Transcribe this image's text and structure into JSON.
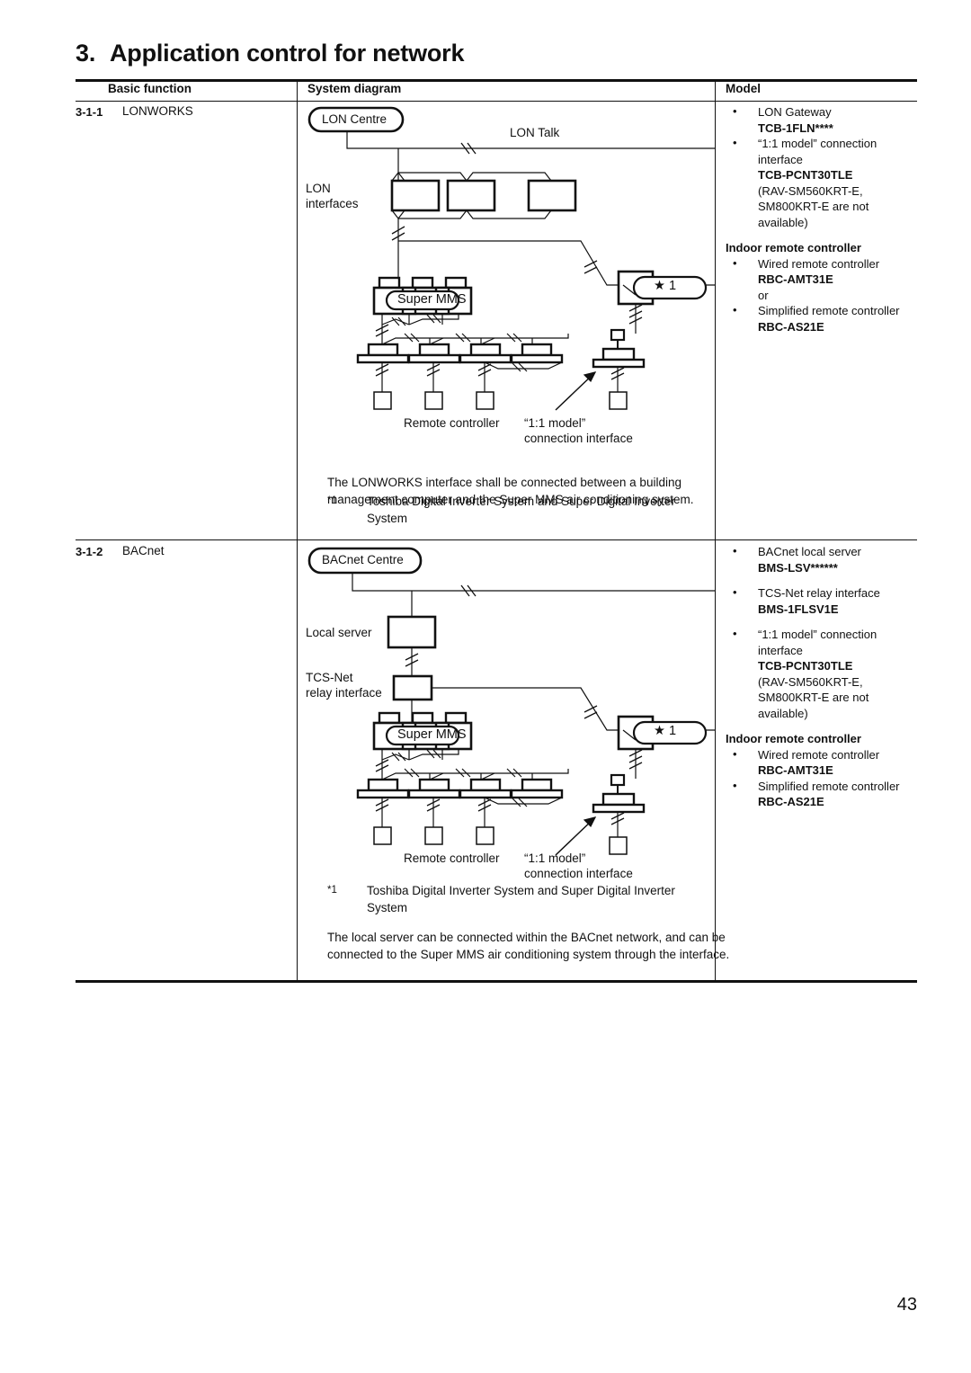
{
  "page": {
    "title_number": "3.",
    "title_text": "Application control for network",
    "page_number": "43"
  },
  "table": {
    "headers": {
      "basic_function": "Basic function",
      "system_diagram": "System diagram",
      "model": "Model"
    },
    "rows": [
      {
        "index": "3-1-1",
        "name": "LONWORKS",
        "diagram": {
          "centre_box": "LON Centre",
          "bus_label": "LON Talk",
          "interfaces_label": "LON\ninterfaces",
          "controller_box": "Super MMS",
          "star_box": "★ 1",
          "remote_controller_label": "Remote controller",
          "one_to_one_label": "“1:1 model”\nconnection interface"
        },
        "footnote_marker": "*1",
        "footnote_text": "Toshiba Digital Inverter System and Super Digital Inverter System",
        "paragraph": "The LONWORKS interface shall be connected between a building management computer and the Super MMS air conditioning system.",
        "model": [
          {
            "style": "bullet",
            "text": "LON Gateway"
          },
          {
            "style": "bold",
            "text": "TCB-1FLN****"
          },
          {
            "style": "bullet",
            "text": "“1:1 model” connection interface"
          },
          {
            "style": "bold",
            "text": "TCB-PCNT30TLE"
          },
          {
            "style": "plain",
            "text": "(RAV-SM560KRT-E,"
          },
          {
            "style": "plain",
            "text": "SM800KRT-E are not available)"
          },
          {
            "style": "gap",
            "text": ""
          },
          {
            "style": "header",
            "text": "Indoor remote controller"
          },
          {
            "style": "bullet",
            "text": "Wired remote controller"
          },
          {
            "style": "bold",
            "text": "RBC-AMT31E"
          },
          {
            "style": "plain",
            "text": "or"
          },
          {
            "style": "bullet",
            "text": "Simplified remote controller"
          },
          {
            "style": "bold",
            "text": "RBC-AS21E"
          }
        ]
      },
      {
        "index": "3-1-2",
        "name": "BACnet",
        "diagram": {
          "centre_box": "BACnet Centre",
          "local_server_label": "Local server",
          "relay_label": "TCS-Net\nrelay interface",
          "controller_box": "Super MMS",
          "star_box": "★ 1",
          "remote_controller_label": "Remote controller",
          "one_to_one_label": "“1:1 model”\nconnection interface"
        },
        "footnote_marker": "*1",
        "footnote_text": "Toshiba Digital Inverter System and Super Digital Inverter System",
        "paragraph": "The local server can be connected within the BACnet network, and can be connected to the Super MMS air conditioning system through the interface.",
        "model": [
          {
            "style": "bullet",
            "text": "BACnet local server"
          },
          {
            "style": "bold",
            "text": "BMS-LSV******"
          },
          {
            "style": "gap",
            "text": ""
          },
          {
            "style": "bullet",
            "text": "TCS-Net relay interface"
          },
          {
            "style": "bold",
            "text": "BMS-1FLSV1E"
          },
          {
            "style": "gap",
            "text": ""
          },
          {
            "style": "bullet",
            "text": "“1:1 model” connection interface"
          },
          {
            "style": "bold",
            "text": "TCB-PCNT30TLE"
          },
          {
            "style": "plain",
            "text": "(RAV-SM560KRT-E,"
          },
          {
            "style": "plain",
            "text": "SM800KRT-E are not available)"
          },
          {
            "style": "gap",
            "text": ""
          },
          {
            "style": "header",
            "text": "Indoor remote controller"
          },
          {
            "style": "bullet",
            "text": "Wired remote controller"
          },
          {
            "style": "bold",
            "text": "RBC-AMT31E"
          },
          {
            "style": "bullet",
            "text": "Simplified remote controller"
          },
          {
            "style": "bold",
            "text": "RBC-AS21E"
          }
        ]
      }
    ]
  },
  "colors": {
    "rule": "#111111",
    "text": "#111111",
    "background": "#ffffff"
  }
}
